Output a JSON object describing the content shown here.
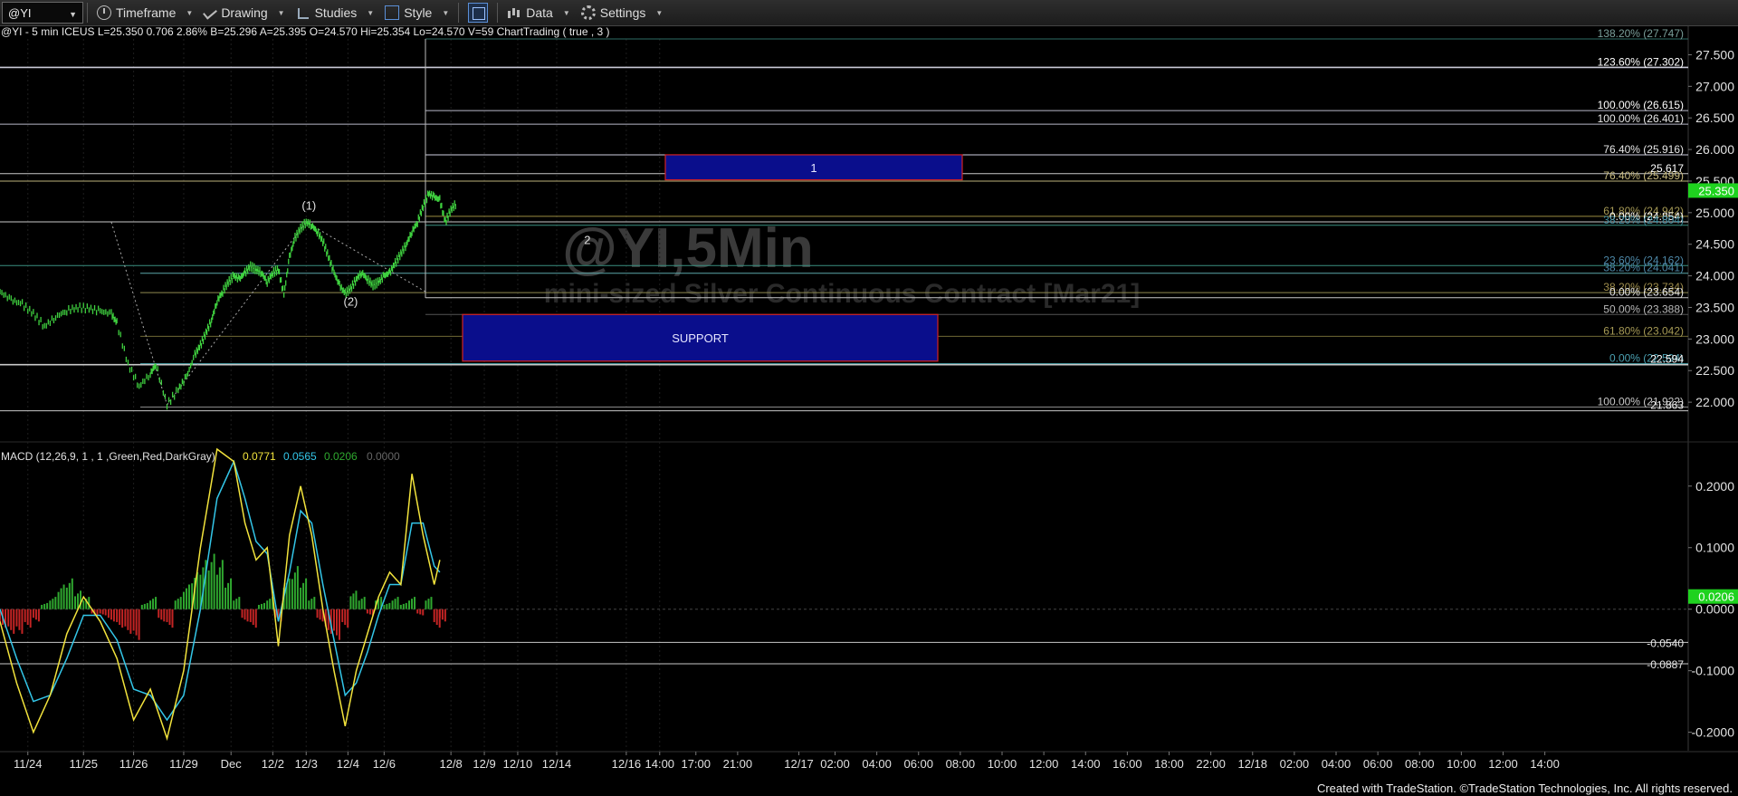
{
  "toolbar": {
    "symbol": "@YI",
    "timeframe": "Timeframe",
    "drawing": "Drawing",
    "studies": "Studies",
    "style": "Style",
    "data": "Data",
    "settings": "Settings"
  },
  "header": {
    "info": "@YI - 5 min  ICEUS  L=25.350  0.706  2.86%  B=25.296  A=25.395  O=24.570  Hi=25.354  Lo=24.570  V=59  ChartTrading ( true , 3 )"
  },
  "watermark": {
    "symbol": "@YI,5Min",
    "description": "mini-sized Silver Continuous Contract [Mar21]"
  },
  "footer": "Created with TradeStation. ©TradeStation Technologies, Inc. All rights reserved.",
  "chart_data": [
    {
      "type": "line",
      "ylim": [
        21.5,
        27.75
      ],
      "y_ticks": [
        "27.500",
        "27.000",
        "26.500",
        "26.000",
        "25.500",
        "25.000",
        "24.500",
        "24.000",
        "23.500",
        "23.000",
        "22.500",
        "22.000"
      ],
      "last_price": "25.350",
      "price_series": [
        {
          "d": 0.0,
          "p": 23.75
        },
        {
          "d": 0.2,
          "p": 23.62
        },
        {
          "d": 0.4,
          "p": 23.55
        },
        {
          "d": 0.6,
          "p": 23.4
        },
        {
          "d": 0.8,
          "p": 23.2
        },
        {
          "d": 1.0,
          "p": 23.35
        },
        {
          "d": 1.2,
          "p": 23.45
        },
        {
          "d": 1.4,
          "p": 23.5
        },
        {
          "d": 1.6,
          "p": 23.48
        },
        {
          "d": 1.8,
          "p": 23.44
        },
        {
          "d": 2.0,
          "p": 23.4
        },
        {
          "d": 2.1,
          "p": 23.25
        },
        {
          "d": 2.3,
          "p": 22.6
        },
        {
          "d": 2.5,
          "p": 22.25
        },
        {
          "d": 2.7,
          "p": 22.45
        },
        {
          "d": 2.8,
          "p": 22.6
        },
        {
          "d": 3.0,
          "p": 21.96
        },
        {
          "d": 3.2,
          "p": 22.2
        },
        {
          "d": 3.35,
          "p": 22.4
        },
        {
          "d": 3.5,
          "p": 22.75
        },
        {
          "d": 3.6,
          "p": 22.9
        },
        {
          "d": 3.7,
          "p": 23.1
        },
        {
          "d": 3.8,
          "p": 23.3
        },
        {
          "d": 3.9,
          "p": 23.6
        },
        {
          "d": 4.0,
          "p": 23.75
        },
        {
          "d": 4.1,
          "p": 23.9
        },
        {
          "d": 4.2,
          "p": 24.0
        },
        {
          "d": 4.3,
          "p": 23.95
        },
        {
          "d": 4.4,
          "p": 24.05
        },
        {
          "d": 4.5,
          "p": 24.15
        },
        {
          "d": 4.6,
          "p": 24.1
        },
        {
          "d": 4.7,
          "p": 24.05
        },
        {
          "d": 4.8,
          "p": 23.9
        },
        {
          "d": 4.9,
          "p": 24.05
        },
        {
          "d": 5.0,
          "p": 24.1
        },
        {
          "d": 5.1,
          "p": 23.7
        },
        {
          "d": 5.2,
          "p": 24.3
        },
        {
          "d": 5.3,
          "p": 24.6
        },
        {
          "d": 5.4,
          "p": 24.75
        },
        {
          "d": 5.5,
          "p": 24.85
        },
        {
          "d": 5.6,
          "p": 24.8
        },
        {
          "d": 5.7,
          "p": 24.7
        },
        {
          "d": 5.8,
          "p": 24.55
        },
        {
          "d": 5.9,
          "p": 24.3
        },
        {
          "d": 6.0,
          "p": 24.05
        },
        {
          "d": 6.1,
          "p": 23.85
        },
        {
          "d": 6.2,
          "p": 23.72
        },
        {
          "d": 6.3,
          "p": 23.8
        },
        {
          "d": 6.4,
          "p": 23.95
        },
        {
          "d": 6.5,
          "p": 24.05
        },
        {
          "d": 6.6,
          "p": 23.95
        },
        {
          "d": 6.7,
          "p": 23.85
        },
        {
          "d": 6.8,
          "p": 23.9
        },
        {
          "d": 6.9,
          "p": 24.0
        },
        {
          "d": 7.0,
          "p": 24.05
        },
        {
          "d": 7.1,
          "p": 24.2
        },
        {
          "d": 7.2,
          "p": 24.35
        },
        {
          "d": 7.3,
          "p": 24.5
        },
        {
          "d": 7.4,
          "p": 24.7
        },
        {
          "d": 7.5,
          "p": 24.85
        },
        {
          "d": 7.6,
          "p": 25.1
        },
        {
          "d": 7.7,
          "p": 25.3
        },
        {
          "d": 7.8,
          "p": 25.25
        },
        {
          "d": 7.9,
          "p": 25.2
        },
        {
          "d": 8.0,
          "p": 24.85
        },
        {
          "d": 8.1,
          "p": 25.05
        },
        {
          "d": 8.2,
          "p": 25.15
        }
      ],
      "horizontal_levels": [
        {
          "price": 27.75,
          "label": "138.20% (27.747)"
        },
        {
          "price": 27.3,
          "label": "123.60% (27.302)"
        },
        {
          "price": 26.615,
          "label": "100.00% (26.615)"
        },
        {
          "price": 26.401,
          "label": "100.00% (26.401)"
        },
        {
          "price": 25.916,
          "label": "76.40% (25.916)"
        },
        {
          "price": 25.617,
          "label": "25.617"
        },
        {
          "price": 25.5,
          "label": "76.40% (25.499)"
        },
        {
          "price": 24.942,
          "label": "61.80% (24.942)"
        },
        {
          "price": 24.854,
          "label": "0.00% (24.854)"
        },
        {
          "price": 24.8,
          "label": "38.20% (24.804)"
        },
        {
          "price": 24.162,
          "label": "23.60% (24.162)"
        },
        {
          "price": 24.041,
          "label": "38.20% (24.041)"
        },
        {
          "price": 23.734,
          "label": "38.20% (23.734)"
        },
        {
          "price": 23.654,
          "label": "0.00% (23.654)"
        },
        {
          "price": 23.388,
          "label": "50.00% (23.388)"
        },
        {
          "price": 23.042,
          "label": "61.80% (23.042)"
        },
        {
          "price": 22.61,
          "label": "0.00% (22.594)"
        },
        {
          "price": 22.594,
          "label": "22.594"
        },
        {
          "price": 21.922,
          "label": "100.00% (21.922)"
        },
        {
          "price": 21.863,
          "label": "21.863"
        }
      ],
      "zones": [
        {
          "label": "1",
          "top": 25.916,
          "bottom": 25.52
        },
        {
          "label": "SUPPORT",
          "top": 23.388,
          "bottom": 22.65
        }
      ],
      "wave_labels": [
        {
          "text": "(1)",
          "d": 5.55,
          "p": 25.05
        },
        {
          "text": "(2)",
          "d": 6.3,
          "p": 23.53
        },
        {
          "text": "2",
          "d": 10.55,
          "p": 24.5
        }
      ]
    },
    {
      "type": "line",
      "title": "MACD (12,26,9, 1 , 1 ,Green,Red,DarkGray)",
      "values_text": [
        "0.0771",
        "0.0565",
        "0.0206",
        "0.0000"
      ],
      "ylim": [
        -0.23,
        0.26
      ],
      "y_ticks": [
        "0.2000",
        "0.1000",
        "0.0000",
        "-0.1000",
        "-0.2000"
      ],
      "last_value": "0.0206",
      "ref_levels": [
        {
          "value": -0.054,
          "label": "-0.0540"
        },
        {
          "value": -0.0887,
          "label": "-0.0887"
        }
      ],
      "macd_line": [
        {
          "d": 0.0,
          "v": -0.02
        },
        {
          "d": 0.3,
          "v": -0.12
        },
        {
          "d": 0.6,
          "v": -0.2
        },
        {
          "d": 0.9,
          "v": -0.14
        },
        {
          "d": 1.2,
          "v": -0.04
        },
        {
          "d": 1.5,
          "v": 0.02
        },
        {
          "d": 1.8,
          "v": -0.02
        },
        {
          "d": 2.1,
          "v": -0.08
        },
        {
          "d": 2.4,
          "v": -0.18
        },
        {
          "d": 2.7,
          "v": -0.13
        },
        {
          "d": 3.0,
          "v": -0.21
        },
        {
          "d": 3.3,
          "v": -0.1
        },
        {
          "d": 3.6,
          "v": 0.1
        },
        {
          "d": 3.9,
          "v": 0.26
        },
        {
          "d": 4.2,
          "v": 0.24
        },
        {
          "d": 4.4,
          "v": 0.14
        },
        {
          "d": 4.6,
          "v": 0.08
        },
        {
          "d": 4.8,
          "v": 0.1
        },
        {
          "d": 5.0,
          "v": -0.06
        },
        {
          "d": 5.2,
          "v": 0.12
        },
        {
          "d": 5.4,
          "v": 0.2
        },
        {
          "d": 5.6,
          "v": 0.12
        },
        {
          "d": 5.8,
          "v": 0.0
        },
        {
          "d": 6.0,
          "v": -0.1
        },
        {
          "d": 6.2,
          "v": -0.19
        },
        {
          "d": 6.4,
          "v": -0.1
        },
        {
          "d": 6.6,
          "v": -0.04
        },
        {
          "d": 6.8,
          "v": 0.02
        },
        {
          "d": 7.0,
          "v": 0.06
        },
        {
          "d": 7.2,
          "v": 0.04
        },
        {
          "d": 7.4,
          "v": 0.22
        },
        {
          "d": 7.6,
          "v": 0.12
        },
        {
          "d": 7.8,
          "v": 0.04
        },
        {
          "d": 7.9,
          "v": 0.08
        }
      ],
      "signal_line": [
        {
          "d": 0.0,
          "v": 0.0
        },
        {
          "d": 0.3,
          "v": -0.08
        },
        {
          "d": 0.6,
          "v": -0.15
        },
        {
          "d": 0.9,
          "v": -0.14
        },
        {
          "d": 1.2,
          "v": -0.08
        },
        {
          "d": 1.5,
          "v": -0.01
        },
        {
          "d": 1.8,
          "v": -0.01
        },
        {
          "d": 2.1,
          "v": -0.05
        },
        {
          "d": 2.4,
          "v": -0.13
        },
        {
          "d": 2.7,
          "v": -0.14
        },
        {
          "d": 3.0,
          "v": -0.18
        },
        {
          "d": 3.3,
          "v": -0.14
        },
        {
          "d": 3.6,
          "v": 0.0
        },
        {
          "d": 3.9,
          "v": 0.18
        },
        {
          "d": 4.2,
          "v": 0.24
        },
        {
          "d": 4.4,
          "v": 0.18
        },
        {
          "d": 4.6,
          "v": 0.11
        },
        {
          "d": 4.8,
          "v": 0.09
        },
        {
          "d": 5.0,
          "v": -0.02
        },
        {
          "d": 5.2,
          "v": 0.06
        },
        {
          "d": 5.4,
          "v": 0.16
        },
        {
          "d": 5.6,
          "v": 0.14
        },
        {
          "d": 5.8,
          "v": 0.04
        },
        {
          "d": 6.0,
          "v": -0.05
        },
        {
          "d": 6.2,
          "v": -0.14
        },
        {
          "d": 6.4,
          "v": -0.12
        },
        {
          "d": 6.6,
          "v": -0.07
        },
        {
          "d": 6.8,
          "v": -0.01
        },
        {
          "d": 7.0,
          "v": 0.04
        },
        {
          "d": 7.2,
          "v": 0.04
        },
        {
          "d": 7.4,
          "v": 0.14
        },
        {
          "d": 7.6,
          "v": 0.14
        },
        {
          "d": 7.8,
          "v": 0.07
        },
        {
          "d": 7.9,
          "v": 0.06
        }
      ],
      "histogram": [
        {
          "d": 0.0,
          "v": -0.03
        },
        {
          "d": 0.15,
          "v": -0.04
        },
        {
          "d": 0.3,
          "v": -0.04
        },
        {
          "d": 0.45,
          "v": -0.03
        },
        {
          "d": 0.6,
          "v": -0.02
        },
        {
          "d": 0.75,
          "v": 0.01
        },
        {
          "d": 0.9,
          "v": 0.02
        },
        {
          "d": 1.05,
          "v": 0.04
        },
        {
          "d": 1.2,
          "v": 0.05
        },
        {
          "d": 1.35,
          "v": 0.03
        },
        {
          "d": 1.5,
          "v": 0.02
        },
        {
          "d": 1.65,
          "v": -0.01
        },
        {
          "d": 1.8,
          "v": -0.01
        },
        {
          "d": 1.95,
          "v": -0.02
        },
        {
          "d": 2.1,
          "v": -0.03
        },
        {
          "d": 2.25,
          "v": -0.04
        },
        {
          "d": 2.4,
          "v": -0.05
        },
        {
          "d": 2.55,
          "v": 0.01
        },
        {
          "d": 2.7,
          "v": 0.02
        },
        {
          "d": 2.85,
          "v": -0.02
        },
        {
          "d": 3.0,
          "v": -0.03
        },
        {
          "d": 3.15,
          "v": 0.02
        },
        {
          "d": 3.3,
          "v": 0.04
        },
        {
          "d": 3.45,
          "v": 0.06
        },
        {
          "d": 3.6,
          "v": 0.08
        },
        {
          "d": 3.75,
          "v": 0.09
        },
        {
          "d": 3.9,
          "v": 0.08
        },
        {
          "d": 4.05,
          "v": 0.05
        },
        {
          "d": 4.2,
          "v": 0.02
        },
        {
          "d": 4.35,
          "v": -0.02
        },
        {
          "d": 4.5,
          "v": -0.03
        },
        {
          "d": 4.65,
          "v": 0.01
        },
        {
          "d": 4.8,
          "v": 0.02
        },
        {
          "d": 4.95,
          "v": -0.02
        },
        {
          "d": 5.1,
          "v": 0.05
        },
        {
          "d": 5.25,
          "v": 0.07
        },
        {
          "d": 5.4,
          "v": 0.05
        },
        {
          "d": 5.55,
          "v": 0.02
        },
        {
          "d": 5.7,
          "v": -0.02
        },
        {
          "d": 5.85,
          "v": -0.04
        },
        {
          "d": 6.0,
          "v": -0.05
        },
        {
          "d": 6.15,
          "v": -0.03
        },
        {
          "d": 6.3,
          "v": 0.03
        },
        {
          "d": 6.45,
          "v": 0.02
        },
        {
          "d": 6.6,
          "v": -0.01
        },
        {
          "d": 6.75,
          "v": 0.02
        },
        {
          "d": 6.9,
          "v": 0.01
        },
        {
          "d": 7.05,
          "v": 0.02
        },
        {
          "d": 7.2,
          "v": 0.01
        },
        {
          "d": 7.35,
          "v": 0.02
        },
        {
          "d": 7.5,
          "v": -0.01
        },
        {
          "d": 7.65,
          "v": 0.02
        },
        {
          "d": 7.8,
          "v": -0.03
        },
        {
          "d": 7.9,
          "v": -0.02
        }
      ]
    }
  ],
  "time_axis": [
    {
      "label": "11/24",
      "d": 0.5
    },
    {
      "label": "11/25",
      "d": 1.5
    },
    {
      "label": "11/26",
      "d": 2.4
    },
    {
      "label": "11/29",
      "d": 3.3
    },
    {
      "label": "Dec",
      "d": 4.15
    },
    {
      "label": "12/2",
      "d": 4.9
    },
    {
      "label": "12/3",
      "d": 5.5
    },
    {
      "label": "12/4",
      "d": 6.25
    },
    {
      "label": "12/6",
      "d": 6.9
    },
    {
      "label": "12/8",
      "d": 8.1
    },
    {
      "label": "12/9",
      "d": 8.7
    },
    {
      "label": "12/10",
      "d": 9.3
    },
    {
      "label": "12/14",
      "d": 10.0
    },
    {
      "label": "12/16",
      "d": 11.25
    },
    {
      "label": "14:00",
      "d": 11.85
    },
    {
      "label": "17:00",
      "d": 12.5
    },
    {
      "label": "21:00",
      "d": 13.25
    },
    {
      "label": "12/17",
      "d": 14.35
    },
    {
      "label": "02:00",
      "d": 15.0
    },
    {
      "label": "04:00",
      "d": 15.75
    },
    {
      "label": "06:00",
      "d": 16.5
    },
    {
      "label": "08:00",
      "d": 17.25
    },
    {
      "label": "10:00",
      "d": 18.0
    },
    {
      "label": "12:00",
      "d": 18.75
    },
    {
      "label": "14:00",
      "d": 19.5
    },
    {
      "label": "16:00",
      "d": 20.25
    },
    {
      "label": "18:00",
      "d": 21.0
    },
    {
      "label": "22:00",
      "d": 21.75
    },
    {
      "label": "12/18",
      "d": 22.5
    },
    {
      "label": "02:00",
      "d": 23.25
    },
    {
      "label": "04:00",
      "d": 24.0
    },
    {
      "label": "06:00",
      "d": 24.75
    },
    {
      "label": "08:00",
      "d": 25.5
    },
    {
      "label": "10:00",
      "d": 26.25
    },
    {
      "label": "12:00",
      "d": 27.0
    },
    {
      "label": "14:00",
      "d": 27.75
    }
  ],
  "colors": {
    "background": "#000000",
    "price": "#3fd03f",
    "zone_fill": "#0a0e8c",
    "zone_border": "#d22222",
    "macd": "#f2e33c",
    "signal": "#33c6e8",
    "hist_up": "#2fa82f",
    "hist_down": "#c42424",
    "last_price_bg": "#1fd21f"
  }
}
